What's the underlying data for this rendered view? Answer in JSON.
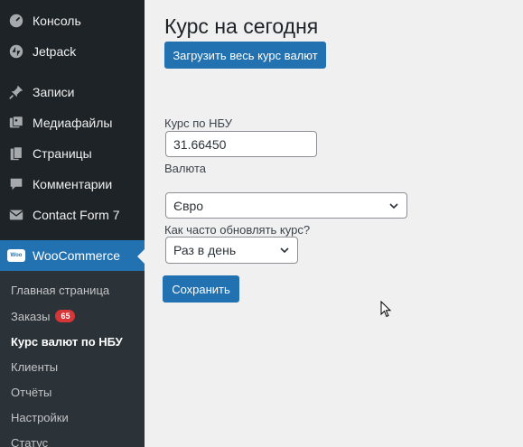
{
  "sidebar": {
    "items": [
      {
        "label": "Консоль",
        "icon": "dashboard-icon"
      },
      {
        "label": "Jetpack",
        "icon": "jetpack-icon"
      },
      {
        "label": "Записи",
        "icon": "pin-icon"
      },
      {
        "label": "Медиафайлы",
        "icon": "media-icon"
      },
      {
        "label": "Страницы",
        "icon": "pages-icon"
      },
      {
        "label": "Комментарии",
        "icon": "comment-icon"
      },
      {
        "label": "Contact Form 7",
        "icon": "mail-icon"
      },
      {
        "label": "WooCommerce",
        "icon": "woocommerce-icon"
      }
    ],
    "woo_icon_text": "Woo",
    "submenu": [
      {
        "label": "Главная страница"
      },
      {
        "label": "Заказы",
        "badge": "65"
      },
      {
        "label": "Курс валют по НБУ"
      },
      {
        "label": "Клиенты"
      },
      {
        "label": "Отчёты"
      },
      {
        "label": "Настройки"
      },
      {
        "label": "Статус"
      }
    ]
  },
  "main": {
    "title": "Курс на сегодня",
    "load_button": "Загрузить весь курс валют",
    "rate_label": "Курс по НБУ",
    "rate_value": "31.66450",
    "currency_label": "Валюта",
    "currency_value": "Євро",
    "frequency_label": "Как часто обновлять курс?",
    "frequency_value": "Раз в день",
    "save_button": "Сохранить"
  },
  "colors": {
    "sidebar_bg": "#1d2327",
    "submenu_bg": "#2c3338",
    "accent": "#2271b1",
    "badge": "#d63638",
    "content_bg": "#f0f0f1"
  }
}
